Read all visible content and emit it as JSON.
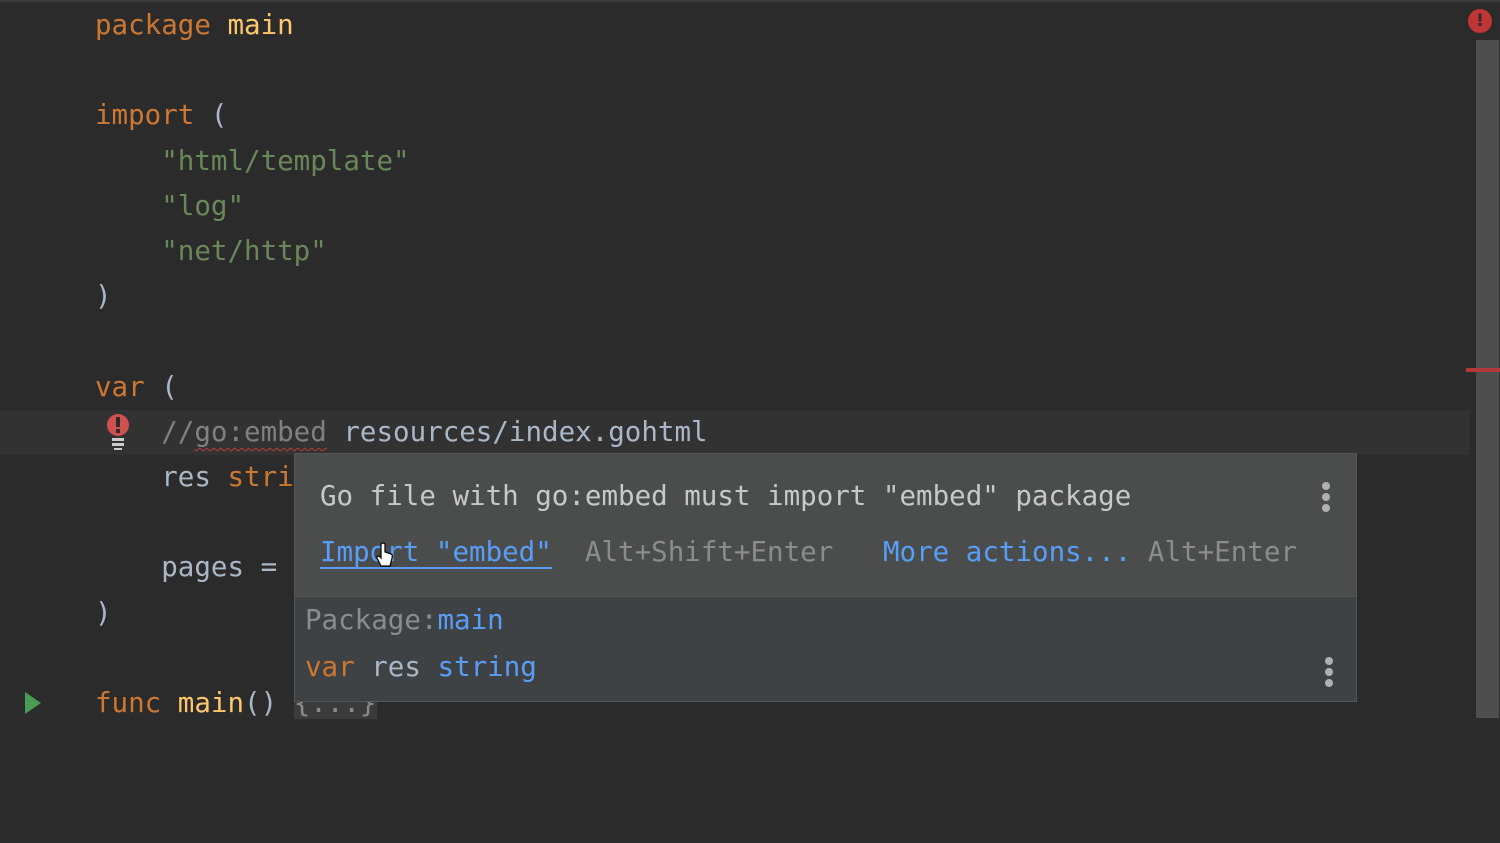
{
  "colors": {
    "background": "#2b2b2b",
    "keyword": "#cc7832",
    "function": "#ffc66d",
    "string": "#6a8759",
    "link": "#589df6",
    "error": "#c03535",
    "run": "#499c54"
  },
  "editor": {
    "lines": [
      {
        "tokens": [
          {
            "t": "kw",
            "text": "package "
          },
          {
            "t": "fn",
            "text": "main"
          }
        ]
      },
      {
        "tokens": []
      },
      {
        "tokens": [
          {
            "t": "kw",
            "text": "import "
          },
          {
            "t": "plain",
            "text": "("
          }
        ]
      },
      {
        "tokens": [
          {
            "t": "str",
            "text": "    \"html/template\""
          }
        ]
      },
      {
        "tokens": [
          {
            "t": "str",
            "text": "    \"log\""
          }
        ]
      },
      {
        "tokens": [
          {
            "t": "str",
            "text": "    \"net/http\""
          }
        ]
      },
      {
        "tokens": [
          {
            "t": "plain",
            "text": ")"
          }
        ]
      },
      {
        "tokens": []
      },
      {
        "tokens": [
          {
            "t": "kw",
            "text": "var "
          },
          {
            "t": "plain",
            "text": "("
          }
        ]
      },
      {
        "current": true,
        "error": true,
        "tokens": [
          {
            "t": "cmt",
            "text": "    //"
          },
          {
            "t": "unused",
            "text": "go:embed"
          },
          {
            "t": "plain",
            "text": " resources/index.gohtml"
          }
        ]
      },
      {
        "tokens": [
          {
            "t": "plain",
            "text": "    res "
          },
          {
            "t": "kw",
            "text": "stri"
          }
        ]
      },
      {
        "tokens": []
      },
      {
        "tokens": [
          {
            "t": "plain",
            "text": "    pages = "
          }
        ]
      },
      {
        "tokens": [
          {
            "t": "plain",
            "text": ")"
          }
        ]
      },
      {
        "tokens": []
      },
      {
        "run": true,
        "tokens": [
          {
            "t": "kw",
            "text": "func "
          },
          {
            "t": "fn",
            "text": "main"
          },
          {
            "t": "plain",
            "text": "() "
          },
          {
            "t": "fold",
            "text": "{...}"
          }
        ]
      }
    ]
  },
  "popup": {
    "message": "Go file with go:embed must import \"embed\" package",
    "fix_label": "Import \"embed\"",
    "fix_shortcut": "Alt+Shift+Enter",
    "more_label": "More actions...",
    "more_shortcut": "Alt+Enter",
    "package_label": "Package:",
    "package_name": "main",
    "decl_keyword": "var",
    "decl_name": "res",
    "decl_type": "string"
  },
  "status": {
    "error_icon": "error-exclamation-icon"
  }
}
